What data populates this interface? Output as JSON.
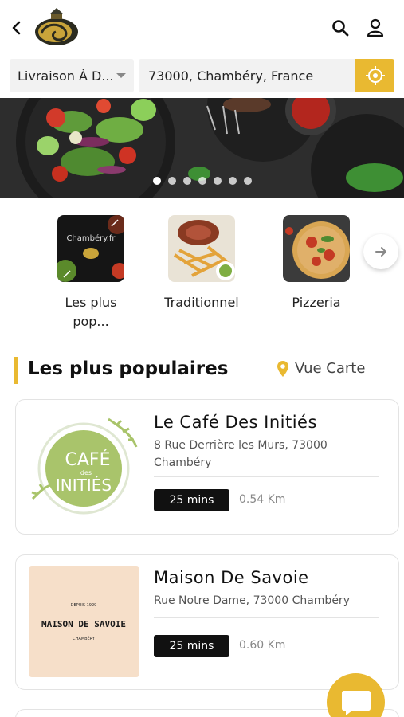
{
  "header": {
    "back_icon": "chevron-left-icon",
    "logo_icon": "brand-logo",
    "search_icon": "search-icon",
    "user_icon": "user-icon"
  },
  "delivery": {
    "mode_label": "Livraison À D...",
    "address_value": "73000, Chambéry, France",
    "locate_icon": "crosshair-icon",
    "accent": "#e9b931"
  },
  "banner": {
    "slide_count": 7,
    "active_index": 0
  },
  "categories": [
    {
      "label": "Les plus pop...",
      "thumb_text": "Chambéry.fr"
    },
    {
      "label": "Traditionnel"
    },
    {
      "label": "Pizzeria"
    }
  ],
  "section": {
    "title": "Les plus populaires",
    "map_link": "Vue Carte"
  },
  "restaurants": [
    {
      "name": "Le Café Des Initiés",
      "address": "8 Rue Derrière les Murs, 73000 Chambéry",
      "time": "25 mins",
      "distance": "0.54 Km",
      "logo_text": {
        "line1": "CAFÉ",
        "line2": "des",
        "line3": "INITIÉS"
      }
    },
    {
      "name": "Maison De Savoie",
      "address": "Rue Notre Dame, 73000 Chambéry",
      "time": "25 mins",
      "distance": "0.60 Km",
      "logo_text": {
        "top": "DEPUIS 1929",
        "main": "MAISON DE SAVOIE",
        "bottom": "CHAMBÉRY"
      }
    }
  ]
}
